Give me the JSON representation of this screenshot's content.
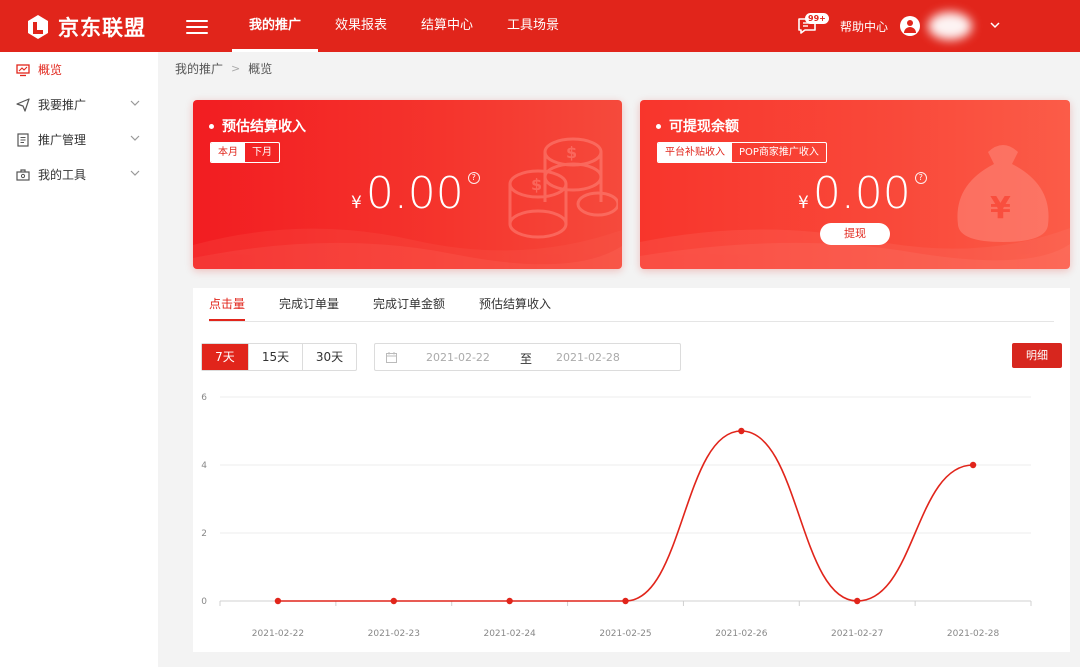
{
  "brand": {
    "logo_text": "京东联盟",
    "accent": "#e1251b"
  },
  "topnav": {
    "items": [
      {
        "label": "我的推广",
        "active": true
      },
      {
        "label": "效果报表",
        "active": false
      },
      {
        "label": "结算中心",
        "active": false
      },
      {
        "label": "工具场景",
        "active": false
      }
    ],
    "message_badge": "99+",
    "help_label": "帮助中心"
  },
  "sidebar": {
    "items": [
      {
        "label": "概览",
        "icon": "monitor-icon",
        "active": true
      },
      {
        "label": "我要推广",
        "icon": "send-icon",
        "expandable": true
      },
      {
        "label": "推广管理",
        "icon": "list-doc-icon",
        "expandable": true
      },
      {
        "label": "我的工具",
        "icon": "toolbox-icon",
        "expandable": true
      }
    ]
  },
  "breadcrumb": {
    "parent": "我的推广",
    "separator": ">",
    "current": "概览"
  },
  "cards": {
    "settlement": {
      "title": "预估结算收入",
      "toggle": [
        "本月",
        "下月"
      ],
      "currency": "¥",
      "amount": "0.00",
      "help": "?"
    },
    "balance": {
      "title": "可提现余额",
      "toggle": [
        "平台补贴收入",
        "POP商家推广收入"
      ],
      "currency": "¥",
      "amount": "0.00",
      "help": "?",
      "withdraw_label": "提现"
    }
  },
  "panel": {
    "tabs": [
      "点击量",
      "完成订单量",
      "完成订单金额",
      "预估结算收入"
    ],
    "active_tab": 0,
    "periods": [
      "7天",
      "15天",
      "30天"
    ],
    "active_period": 0,
    "date_from": "2021-02-22",
    "date_sep": "至",
    "date_to": "2021-02-28",
    "detail_label": "明细"
  },
  "chart_data": {
    "type": "line",
    "title": "",
    "xlabel": "",
    "ylabel": "",
    "categories": [
      "2021-02-22",
      "2021-02-23",
      "2021-02-24",
      "2021-02-25",
      "2021-02-26",
      "2021-02-27",
      "2021-02-28"
    ],
    "series": [
      {
        "values": [
          0,
          0,
          0,
          0,
          5,
          0,
          4
        ],
        "color": "#e1251b"
      }
    ],
    "yticks": [
      0,
      2,
      4,
      6
    ],
    "ylim": [
      0,
      6
    ],
    "grid": true,
    "smooth": true
  }
}
